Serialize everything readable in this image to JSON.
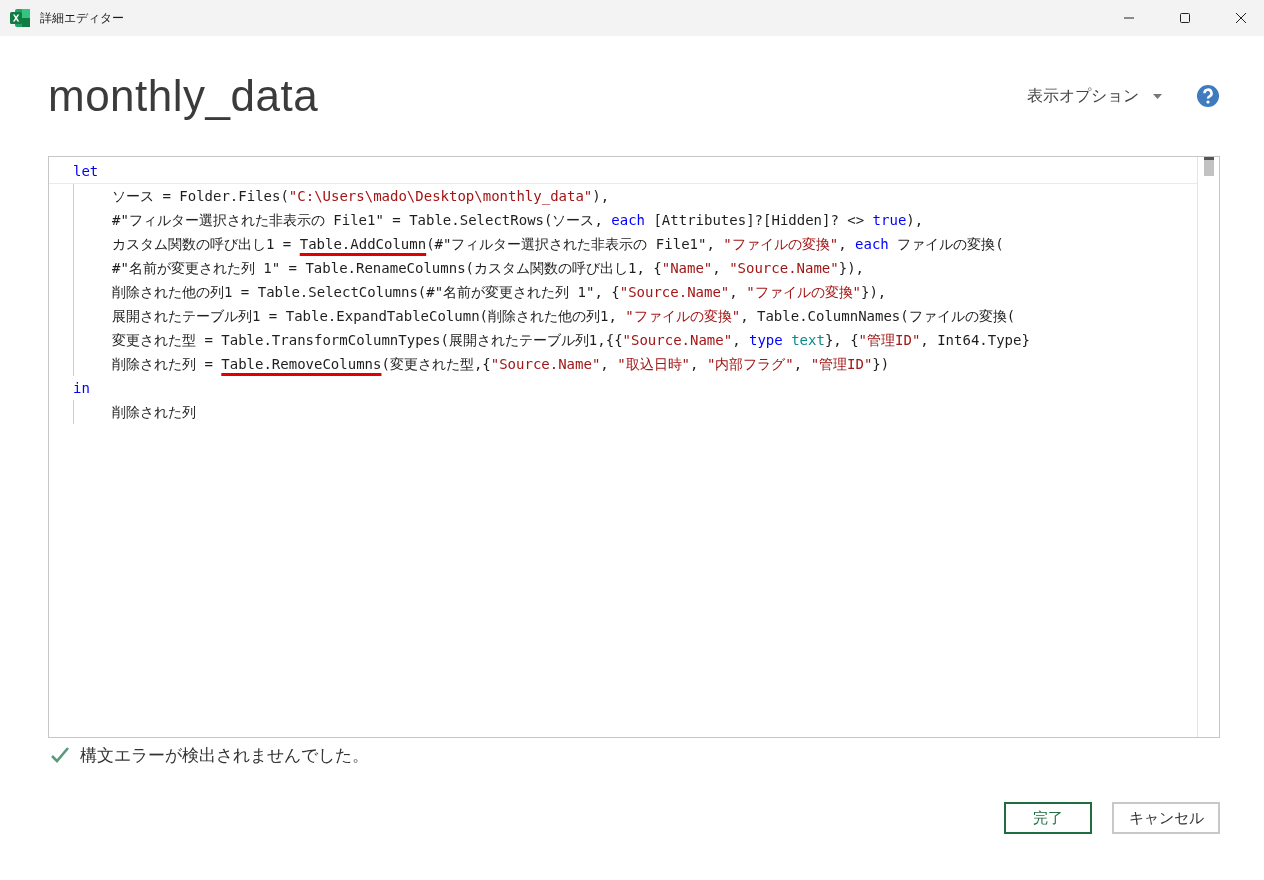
{
  "window": {
    "title": "詳細エディター"
  },
  "query_name": "monthly_data",
  "view_options": {
    "label": "表示オプション"
  },
  "code": [
    {
      "keyword": "let",
      "children": [
        [
          {
            "t": "ソース = Folder.Files(",
            "kind": "plain"
          },
          {
            "t": "\"C:\\Users\\mado\\Desktop\\monthly_data\"",
            "kind": "string"
          },
          {
            "t": "),",
            "kind": "plain"
          }
        ],
        [
          {
            "t": "#\"フィルター選択された非表示の File1\" = Table.SelectRows(ソース, ",
            "kind": "plain"
          },
          {
            "t": "each",
            "kind": "keyword"
          },
          {
            "t": " [Attributes]?[Hidden]? <> ",
            "kind": "plain"
          },
          {
            "t": "true",
            "kind": "keyword"
          },
          {
            "t": "),",
            "kind": "plain"
          }
        ],
        [
          {
            "t": "カスタム関数の呼び出し1 = ",
            "kind": "plain"
          },
          {
            "t": "Table.AddColumn",
            "kind": "plain",
            "underlined": true
          },
          {
            "t": "(#\"フィルター選択された非表示の File1\", ",
            "kind": "plain"
          },
          {
            "t": "\"ファイルの変換\"",
            "kind": "string"
          },
          {
            "t": ", ",
            "kind": "plain"
          },
          {
            "t": "each",
            "kind": "keyword"
          },
          {
            "t": " ファイルの変換(",
            "kind": "plain"
          }
        ],
        [
          {
            "t": "#\"名前が変更された列 1\" = Table.RenameColumns(カスタム関数の呼び出し1, {",
            "kind": "plain"
          },
          {
            "t": "\"Name\"",
            "kind": "string"
          },
          {
            "t": ", ",
            "kind": "plain"
          },
          {
            "t": "\"Source.Name\"",
            "kind": "string"
          },
          {
            "t": "}),",
            "kind": "plain"
          }
        ],
        [
          {
            "t": "削除された他の列1 = Table.SelectColumns(#\"名前が変更された列 1\", {",
            "kind": "plain"
          },
          {
            "t": "\"Source.Name\"",
            "kind": "string"
          },
          {
            "t": ", ",
            "kind": "plain"
          },
          {
            "t": "\"ファイルの変換\"",
            "kind": "string"
          },
          {
            "t": "}),",
            "kind": "plain"
          }
        ],
        [
          {
            "t": "展開されたテーブル列1 = Table.ExpandTableColumn(削除された他の列1, ",
            "kind": "plain"
          },
          {
            "t": "\"ファイルの変換\"",
            "kind": "string"
          },
          {
            "t": ", Table.ColumnNames(ファイルの変換(",
            "kind": "plain"
          }
        ],
        [
          {
            "t": "変更された型 = Table.TransformColumnTypes(展開されたテーブル列1,{{",
            "kind": "plain"
          },
          {
            "t": "\"Source.Name\"",
            "kind": "string"
          },
          {
            "t": ", ",
            "kind": "plain"
          },
          {
            "t": "type ",
            "kind": "keyword"
          },
          {
            "t": "text",
            "kind": "typename"
          },
          {
            "t": "}, {",
            "kind": "plain"
          },
          {
            "t": "\"管理ID\"",
            "kind": "string"
          },
          {
            "t": ", Int64.Type}",
            "kind": "plain"
          }
        ],
        [
          {
            "t": "削除された列 = ",
            "kind": "plain"
          },
          {
            "t": "Table.RemoveColumns",
            "kind": "plain",
            "underlined": true
          },
          {
            "t": "(変更された型,{",
            "kind": "plain"
          },
          {
            "t": "\"Source.Name\"",
            "kind": "string"
          },
          {
            "t": ", ",
            "kind": "plain"
          },
          {
            "t": "\"取込日時\"",
            "kind": "string"
          },
          {
            "t": ", ",
            "kind": "plain"
          },
          {
            "t": "\"内部フラグ\"",
            "kind": "string"
          },
          {
            "t": ", ",
            "kind": "plain"
          },
          {
            "t": "\"管理ID\"",
            "kind": "string"
          },
          {
            "t": "})",
            "kind": "plain"
          }
        ]
      ]
    },
    {
      "keyword": "in",
      "children": [
        [
          {
            "t": "削除された列",
            "kind": "plain"
          }
        ]
      ]
    }
  ],
  "status": {
    "ok": true,
    "message": "構文エラーが検出されませんでした。"
  },
  "buttons": [
    {
      "label": "完了",
      "primary": true
    },
    {
      "label": "キャンセル",
      "primary": false
    }
  ]
}
